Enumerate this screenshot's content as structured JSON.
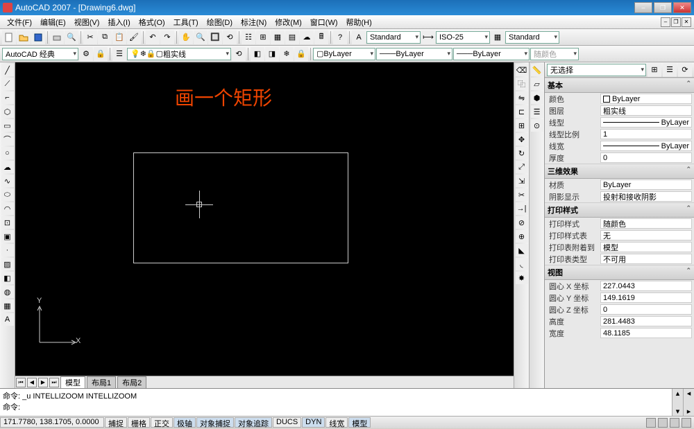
{
  "title": "AutoCAD 2007 - [Drawing6.dwg]",
  "menu": [
    "文件(F)",
    "编辑(E)",
    "视图(V)",
    "插入(I)",
    "格式(O)",
    "工具(T)",
    "绘图(D)",
    "标注(N)",
    "修改(M)",
    "窗口(W)",
    "帮助(H)"
  ],
  "toolbar1": {
    "style1": "Standard",
    "style2": "ISO-25",
    "style3": "Standard"
  },
  "toolbar2": {
    "workspace": "AutoCAD 经典",
    "layer": "粗实线",
    "color": "ByLayer",
    "ltype": "ByLayer",
    "lweight": "ByLayer",
    "plotstyle": "随颜色"
  },
  "canvas": {
    "annotation": "画一个矩形",
    "axis_y": "Y",
    "axis_x": "X"
  },
  "tabs": [
    "模型",
    "布局1",
    "布局2"
  ],
  "cmd": {
    "line1": "命令: _u INTELLIZOOM INTELLIZOOM",
    "line2": "命令:"
  },
  "status": {
    "coord": "171.7780, 138.1705, 0.0000",
    "snaps": [
      "捕捉",
      "栅格",
      "正交",
      "极轴",
      "对象捕捉",
      "对象追踪",
      "DUCS",
      "DYN",
      "线宽",
      "模型"
    ]
  },
  "props": {
    "selection": "无选择",
    "sections": {
      "basic": "基本",
      "threed": "三维效果",
      "print": "打印样式",
      "view": "视图"
    },
    "basic": {
      "color_k": "颜色",
      "color_v": "ByLayer",
      "layer_k": "图层",
      "layer_v": "粗实线",
      "ltype_k": "线型",
      "ltype_v": "ByLayer",
      "ltscale_k": "线型比例",
      "ltscale_v": "1",
      "lweight_k": "线宽",
      "lweight_v": "ByLayer",
      "thick_k": "厚度",
      "thick_v": "0"
    },
    "threed": {
      "mat_k": "材质",
      "mat_v": "ByLayer",
      "shadow_k": "阴影显示",
      "shadow_v": "投射和接收阴影"
    },
    "print": {
      "ps_k": "打印样式",
      "ps_v": "随颜色",
      "pst_k": "打印样式表",
      "pst_v": "无",
      "pat_k": "打印表附着到",
      "pat_v": "模型",
      "ptt_k": "打印表类型",
      "ptt_v": "不可用"
    },
    "view": {
      "cx_k": "圆心 X 坐标",
      "cx_v": "227.0443",
      "cy_k": "圆心 Y 坐标",
      "cy_v": "149.1619",
      "cz_k": "圆心 Z 坐标",
      "cz_v": "0",
      "h_k": "高度",
      "h_v": "281.4483",
      "w_k": "宽度",
      "w_v": "48.1185"
    }
  }
}
